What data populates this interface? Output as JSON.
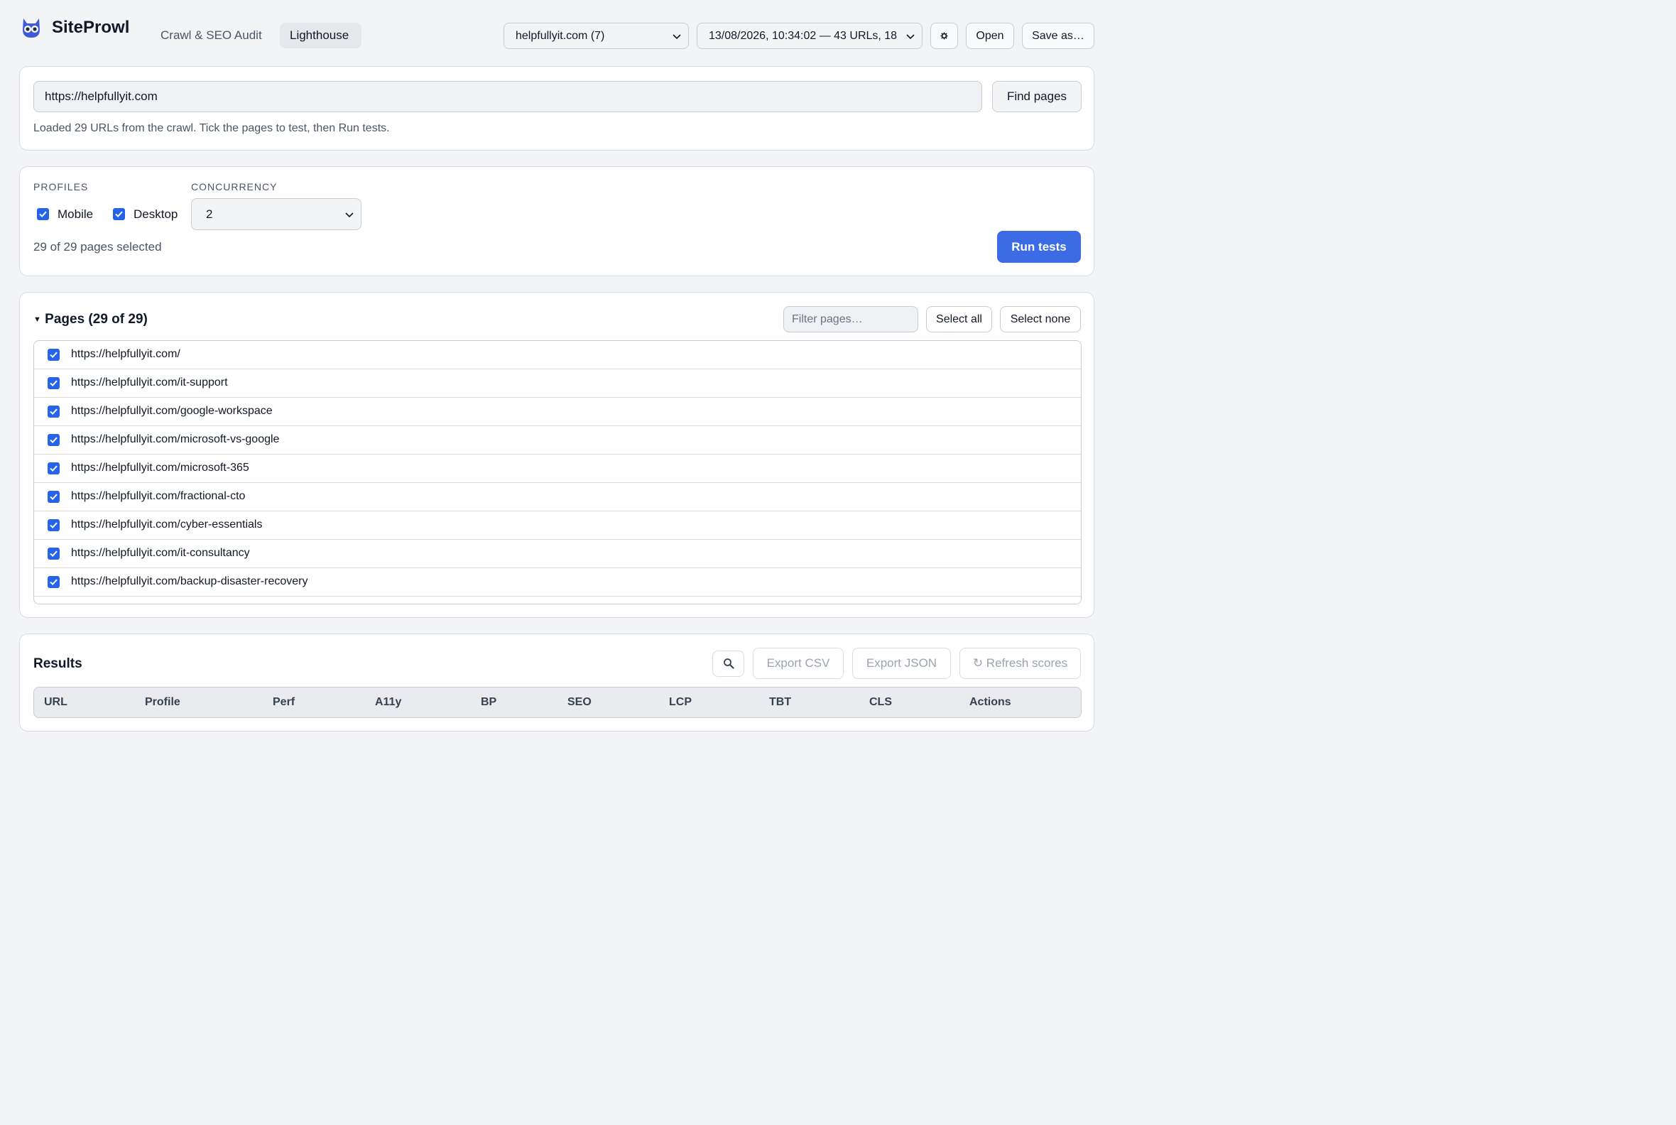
{
  "app": {
    "name": "SiteProwl"
  },
  "nav": {
    "tabs": [
      {
        "label": "Crawl & SEO Audit"
      },
      {
        "label": "Lighthouse"
      }
    ]
  },
  "header": {
    "site_select": "helpfullyit.com (7)",
    "crawl_select": "13/08/2026, 10:34:02 — 43 URLs, 18",
    "settings_icon": "gear-icon",
    "open_label": "Open",
    "save_as_label": "Save as…"
  },
  "url_card": {
    "url_value": "https://helpfullyit.com",
    "find_pages_label": "Find pages",
    "status_text": "Loaded 29 URLs from the crawl. Tick the pages to test, then Run tests."
  },
  "options": {
    "profiles_label": "PROFILES",
    "profiles": [
      {
        "label": "Mobile",
        "checked": true
      },
      {
        "label": "Desktop",
        "checked": true
      }
    ],
    "concurrency_label": "CONCURRENCY",
    "concurrency_value": "2",
    "selected_text": "29 of 29 pages selected",
    "run_label": "Run tests"
  },
  "pages": {
    "title": "Pages (29 of 29)",
    "filter_placeholder": "Filter pages…",
    "select_all_label": "Select all",
    "select_none_label": "Select none",
    "items": [
      "https://helpfullyit.com/",
      "https://helpfullyit.com/it-support",
      "https://helpfullyit.com/google-workspace",
      "https://helpfullyit.com/microsoft-vs-google",
      "https://helpfullyit.com/microsoft-365",
      "https://helpfullyit.com/fractional-cto",
      "https://helpfullyit.com/cyber-essentials",
      "https://helpfullyit.com/it-consultancy",
      "https://helpfullyit.com/backup-disaster-recovery"
    ]
  },
  "results": {
    "title": "Results",
    "search_icon": "magnifier-icon",
    "export_csv_label": "Export CSV",
    "export_json_label": "Export JSON",
    "refresh_label": "↻ Refresh scores",
    "columns": [
      "URL",
      "Profile",
      "Perf",
      "A11y",
      "BP",
      "SEO",
      "LCP",
      "TBT",
      "CLS",
      "Actions"
    ]
  },
  "colors": {
    "accent": "#3b6ce6",
    "checkbox": "#2563eb",
    "background": "#f3f4f6"
  }
}
